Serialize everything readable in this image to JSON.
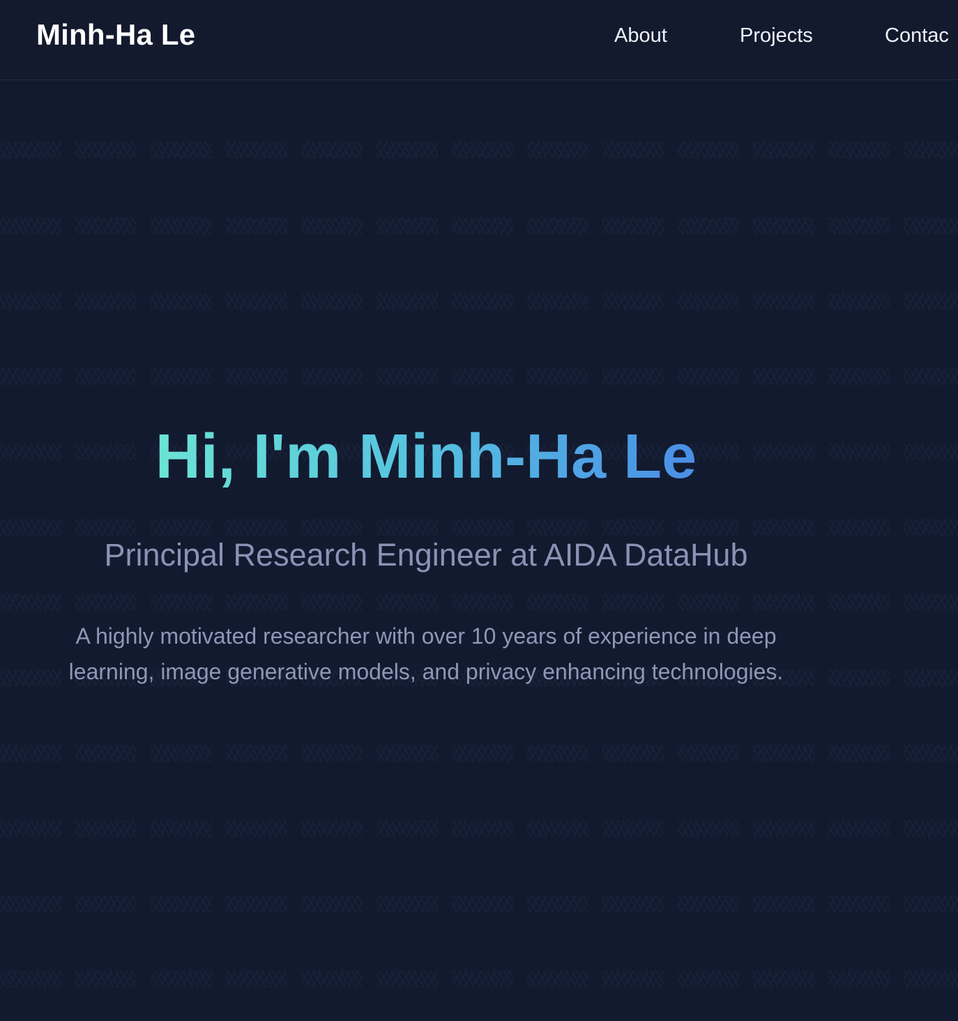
{
  "header": {
    "brand": "Minh-Ha Le",
    "nav": {
      "about": "About",
      "projects": "Projects",
      "contact": "Contac"
    }
  },
  "hero": {
    "greeting": "Hi, I'm Minh-Ha Le",
    "subtitle": "Principal Research Engineer at AIDA DataHub",
    "description": "A highly motivated researcher with over 10 years of experience in deep learning, image generative models, and privacy enhancing technologies."
  },
  "colors": {
    "background": "#121a2f",
    "header_background": "#131a2e",
    "gradient_start": "#6be3d4",
    "gradient_end": "#4a8ee6",
    "muted_text": "#8a92b5"
  }
}
